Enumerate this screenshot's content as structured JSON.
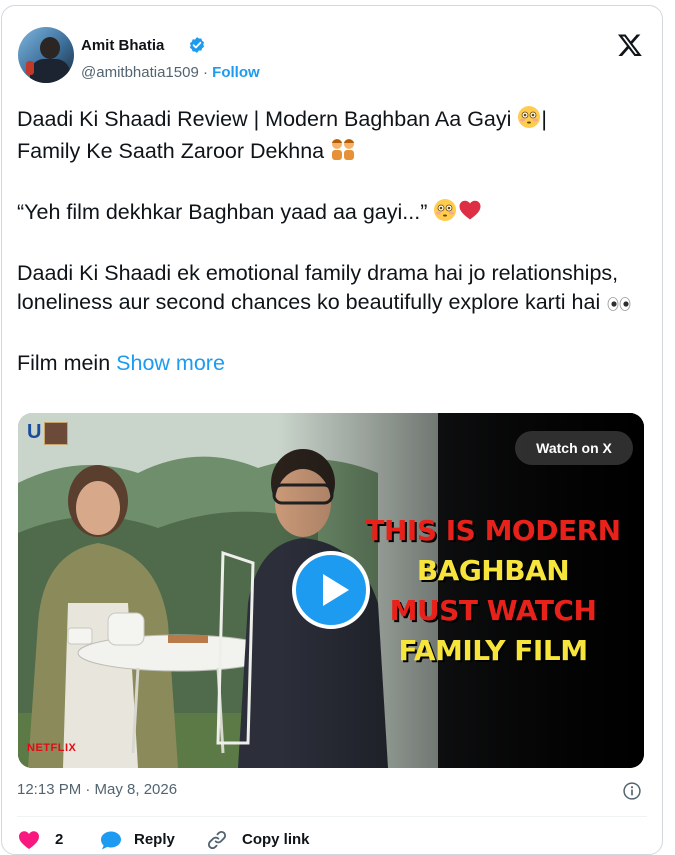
{
  "author": {
    "name": "Amit Bhatia",
    "handle": "@amitbhatia1509",
    "separator": " · ",
    "follow_label": "Follow"
  },
  "tweet": {
    "line1": "Daadi Ki Shaadi Review | Modern Baghban Aa Gayi ",
    "line1b": "| ",
    "line2": "Family Ke Saath Zaroor Dekhna ",
    "quote": "“Yeh film dekhkar Baghban yaad aa gayi...” ",
    "para": "Daadi Ki Shaadi ek emotional family drama hai jo relationships, loneliness aur second chances ko beautifully explore karti hai ",
    "last": "Film mein ",
    "show_more": "Show more"
  },
  "media": {
    "watch_label": "Watch on X",
    "overlay_lines": [
      {
        "text": "THIS IS MODERN",
        "color": "#e8221b"
      },
      {
        "text": "BAGHBAN",
        "color": "#f7e53b"
      },
      {
        "text": "MUST WATCH",
        "color": "#e8221b"
      },
      {
        "text": "FAMILY FILM",
        "color": "#f7e53b"
      }
    ],
    "corner_logo": "U",
    "badge": "NETFLIX"
  },
  "meta": {
    "time": "12:13 PM · May 8, 2026"
  },
  "actions": {
    "like_count": "2",
    "reply_label": "Reply",
    "copy_label": "Copy link"
  },
  "colors": {
    "accent": "#1d9bf0",
    "like": "#f91880",
    "text": "#0f1419",
    "muted": "#536471"
  },
  "icons": [
    "verified-badge-icon",
    "x-logo-icon",
    "play-icon",
    "info-icon",
    "heart-icon",
    "reply-bubble-icon",
    "link-icon"
  ]
}
